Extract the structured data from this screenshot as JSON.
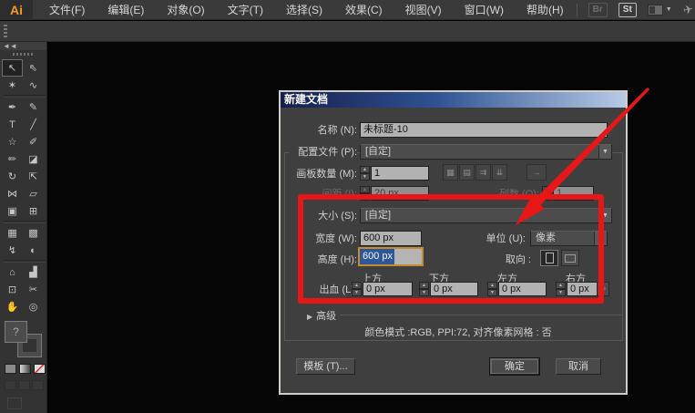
{
  "app": {
    "logo_text": "Ai",
    "menu_items": [
      {
        "label": "文件(F)"
      },
      {
        "label": "编辑(E)"
      },
      {
        "label": "对象(O)"
      },
      {
        "label": "文字(T)"
      },
      {
        "label": "选择(S)"
      },
      {
        "label": "效果(C)"
      },
      {
        "label": "视图(V)"
      },
      {
        "label": "窗口(W)"
      },
      {
        "label": "帮助(H)"
      }
    ],
    "bridge_badge": "Br",
    "stock_badge": "St",
    "workspace_caret": "▼",
    "cslive_glyph": "✈"
  },
  "tools": {
    "collapse_glyph": "◄◄",
    "items": [
      {
        "name": "selection-tool",
        "glyph": "↖",
        "active": true
      },
      {
        "name": "direct-selection-tool",
        "glyph": "⇖",
        "active": false
      },
      {
        "name": "magic-wand-tool",
        "glyph": "✶",
        "active": false
      },
      {
        "name": "lasso-tool",
        "glyph": "∿",
        "active": false
      },
      {
        "name": "pen-tool",
        "glyph": "✒",
        "active": false
      },
      {
        "name": "blob-brush-tool",
        "glyph": "✎",
        "active": false
      },
      {
        "name": "type-tool",
        "glyph": "T",
        "active": false
      },
      {
        "name": "line-segment-tool",
        "glyph": "╱",
        "active": false
      },
      {
        "name": "shape-tool",
        "glyph": "☆",
        "active": false
      },
      {
        "name": "paintbrush-tool",
        "glyph": "✐",
        "active": false
      },
      {
        "name": "pencil-tool",
        "glyph": "✏",
        "active": false
      },
      {
        "name": "eraser-tool",
        "glyph": "◪",
        "active": false
      },
      {
        "name": "rotate-tool",
        "glyph": "↻",
        "active": false
      },
      {
        "name": "scale-tool",
        "glyph": "⇱",
        "active": false
      },
      {
        "name": "width-tool",
        "glyph": "⋈",
        "active": false
      },
      {
        "name": "free-transform-tool",
        "glyph": "▱",
        "active": false
      },
      {
        "name": "shape-builder-tool",
        "glyph": "▣",
        "active": false
      },
      {
        "name": "perspective-grid-tool",
        "glyph": "⊞",
        "active": false
      },
      {
        "name": "mesh-tool",
        "glyph": "▦",
        "active": false
      },
      {
        "name": "gradient-tool",
        "glyph": "▩",
        "active": false
      },
      {
        "name": "eyedropper-tool",
        "glyph": "↯",
        "active": false
      },
      {
        "name": "blend-tool",
        "glyph": "◐",
        "active": false
      },
      {
        "name": "symbol-sprayer-tool",
        "glyph": "⌂",
        "active": false
      },
      {
        "name": "graph-tool",
        "glyph": "▟",
        "active": false
      },
      {
        "name": "artboard-tool",
        "glyph": "⊡",
        "active": false
      },
      {
        "name": "slice-tool",
        "glyph": "✂",
        "active": false
      },
      {
        "name": "hand-tool",
        "glyph": "✋",
        "active": false
      },
      {
        "name": "zoom-tool",
        "glyph": "◎",
        "active": false
      }
    ],
    "fill_stroke_placeholder": "?"
  },
  "dialog": {
    "title": "新建文档",
    "name_label": "名称 (N):",
    "name_value": "未标题-10",
    "profile_label": "配置文件 (P):",
    "profile_value": "[自定]",
    "artboards_label": "画板数量 (M):",
    "artboards_value": "1",
    "arrange_buttons": [
      {
        "name": "grid-by-row-icon",
        "glyph": "▦"
      },
      {
        "name": "grid-by-column-icon",
        "glyph": "▤"
      },
      {
        "name": "arrange-by-row-icon",
        "glyph": "⇉"
      },
      {
        "name": "arrange-by-column-icon",
        "glyph": "⇊"
      }
    ],
    "arrange_direction_glyph": "→",
    "spacing_label": "间距 (I):",
    "spacing_value": "20 px",
    "columns_label": "列数 (O):",
    "columns_value": "1",
    "size_label": "大小 (S):",
    "size_value": "[自定]",
    "width_label": "宽度 (W):",
    "width_value": "600 px",
    "units_label": "单位 (U):",
    "units_value": "像素",
    "height_label": "高度 (H):",
    "height_value": "600 px",
    "orientation_label": "取向 :",
    "bleed_label": "出血 (L):",
    "bleed_fields": [
      {
        "label": "上方",
        "value": "0 px"
      },
      {
        "label": "下方",
        "value": "0 px"
      },
      {
        "label": "左方",
        "value": "0 px"
      },
      {
        "label": "右方",
        "value": "0 px"
      }
    ],
    "advanced_arrow": "▶",
    "advanced_label": "高级",
    "summary": "颜色模式 :RGB, PPI:72, 对齐像素网格 : 否",
    "template_button": "模板 (T)...",
    "ok_button": "确定",
    "cancel_button": "取消",
    "dropdown_arrow": "▼",
    "spin_up": "▲",
    "spin_down": "▼",
    "link_glyph": "∞"
  },
  "annotation": {
    "color": "#e81717"
  }
}
